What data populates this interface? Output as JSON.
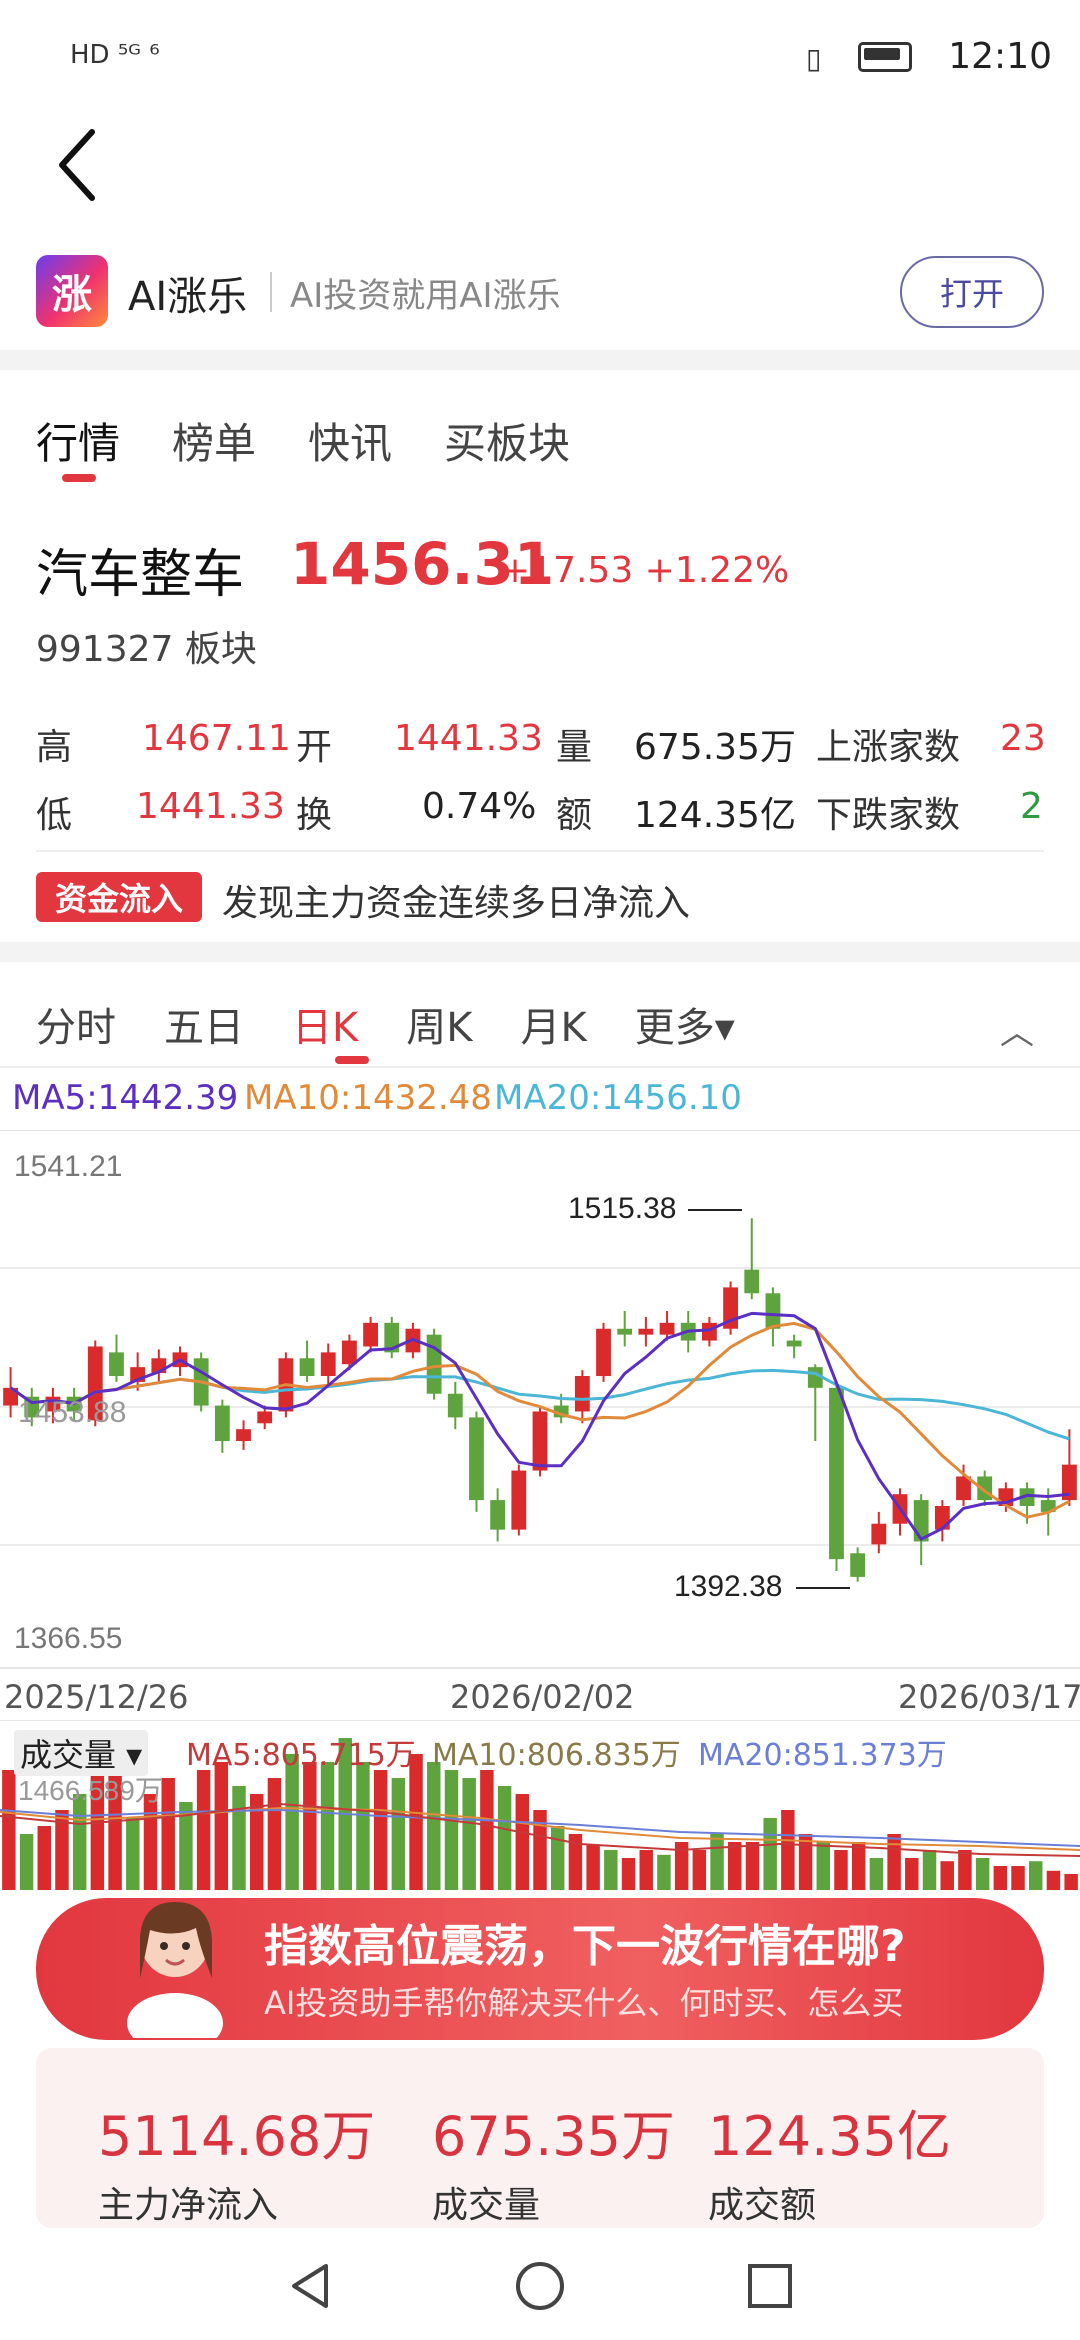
{
  "status": {
    "left_icons": "HD ⁵ᴳ ⁶",
    "time": "12:10"
  },
  "brand": {
    "logo_text": "涨",
    "name": "AI涨乐",
    "slogan": "AI投资就用AI涨乐",
    "open_label": "打开"
  },
  "tabs1": [
    "行情",
    "榜单",
    "快讯",
    "买板块"
  ],
  "security": {
    "name": "汽车整车",
    "price": "1456.31",
    "change": "+17.53 +1.22%",
    "code": "991327 板块"
  },
  "stats": {
    "high_label": "高",
    "high": "1467.11",
    "open_label": "开",
    "open": "1441.33",
    "vol_label": "量",
    "vol": "675.35万",
    "up_label": "上涨家数",
    "up": "23",
    "low_label": "低",
    "low": "1441.33",
    "turn_label": "换",
    "turn": "0.74%",
    "amt_label": "额",
    "amt": "124.35亿",
    "down_label": "下跌家数",
    "down": "2"
  },
  "fund": {
    "tag": "资金流入",
    "text": "发现主力资金连续多日净流入"
  },
  "tabs2": [
    "分时",
    "五日",
    "日K",
    "周K",
    "月K",
    "更多▾"
  ],
  "ma": {
    "ma5": "MA5:1442.39",
    "ma10": "MA10:1432.48",
    "ma20": "MA20:1456.10"
  },
  "chart_data": {
    "type": "candlestick",
    "ymax_label": "1541.21",
    "ymin_label": "1366.55",
    "mid_label": "1453.88",
    "high_label": "1515.38",
    "low_label": "1392.38",
    "ylim": [
      1366.55,
      1541.21
    ],
    "x_labels": [
      "2025/12/26",
      "2026/02/02",
      "2026/03/17"
    ],
    "candles": [
      {
        "o": 1452,
        "c": 1458,
        "h": 1465,
        "l": 1448
      },
      {
        "o": 1455,
        "c": 1448,
        "h": 1458,
        "l": 1445
      },
      {
        "o": 1450,
        "c": 1455,
        "h": 1458,
        "l": 1446
      },
      {
        "o": 1455,
        "c": 1450,
        "h": 1458,
        "l": 1447
      },
      {
        "o": 1447,
        "c": 1472,
        "h": 1474,
        "l": 1445
      },
      {
        "o": 1470,
        "c": 1462,
        "h": 1476,
        "l": 1460
      },
      {
        "o": 1460,
        "c": 1465,
        "h": 1470,
        "l": 1457
      },
      {
        "o": 1463,
        "c": 1468,
        "h": 1471,
        "l": 1460
      },
      {
        "o": 1465,
        "c": 1470,
        "h": 1472,
        "l": 1462
      },
      {
        "o": 1468,
        "c": 1452,
        "h": 1470,
        "l": 1450
      },
      {
        "o": 1452,
        "c": 1440,
        "h": 1454,
        "l": 1436
      },
      {
        "o": 1440,
        "c": 1444,
        "h": 1447,
        "l": 1437
      },
      {
        "o": 1446,
        "c": 1450,
        "h": 1452,
        "l": 1444
      },
      {
        "o": 1450,
        "c": 1468,
        "h": 1470,
        "l": 1448
      },
      {
        "o": 1468,
        "c": 1462,
        "h": 1474,
        "l": 1460
      },
      {
        "o": 1462,
        "c": 1470,
        "h": 1473,
        "l": 1459
      },
      {
        "o": 1466,
        "c": 1474,
        "h": 1476,
        "l": 1464
      },
      {
        "o": 1472,
        "c": 1480,
        "h": 1482,
        "l": 1470
      },
      {
        "o": 1480,
        "c": 1470,
        "h": 1482,
        "l": 1468
      },
      {
        "o": 1470,
        "c": 1478,
        "h": 1480,
        "l": 1468
      },
      {
        "o": 1476,
        "c": 1456,
        "h": 1478,
        "l": 1454
      },
      {
        "o": 1456,
        "c": 1448,
        "h": 1460,
        "l": 1444
      },
      {
        "o": 1448,
        "c": 1420,
        "h": 1450,
        "l": 1416
      },
      {
        "o": 1420,
        "c": 1410,
        "h": 1424,
        "l": 1406
      },
      {
        "o": 1410,
        "c": 1430,
        "h": 1432,
        "l": 1408
      },
      {
        "o": 1430,
        "c": 1450,
        "h": 1452,
        "l": 1428
      },
      {
        "o": 1452,
        "c": 1448,
        "h": 1456,
        "l": 1446
      },
      {
        "o": 1450,
        "c": 1462,
        "h": 1464,
        "l": 1446
      },
      {
        "o": 1462,
        "c": 1478,
        "h": 1480,
        "l": 1460
      },
      {
        "o": 1478,
        "c": 1476,
        "h": 1484,
        "l": 1472
      },
      {
        "o": 1476,
        "c": 1478,
        "h": 1482,
        "l": 1472
      },
      {
        "o": 1476,
        "c": 1480,
        "h": 1484,
        "l": 1474
      },
      {
        "o": 1480,
        "c": 1474,
        "h": 1484,
        "l": 1470
      },
      {
        "o": 1474,
        "c": 1480,
        "h": 1482,
        "l": 1472
      },
      {
        "o": 1478,
        "c": 1492,
        "h": 1494,
        "l": 1476
      },
      {
        "o": 1498,
        "c": 1490,
        "h": 1515.38,
        "l": 1488
      },
      {
        "o": 1490,
        "c": 1478,
        "h": 1492,
        "l": 1472
      },
      {
        "o": 1474,
        "c": 1472,
        "h": 1476,
        "l": 1468
      },
      {
        "o": 1465,
        "c": 1458,
        "h": 1466,
        "l": 1440
      },
      {
        "o": 1458,
        "c": 1400,
        "h": 1460,
        "l": 1396
      },
      {
        "o": 1402,
        "c": 1394,
        "h": 1404,
        "l": 1392.38
      },
      {
        "o": 1405,
        "c": 1412,
        "h": 1416,
        "l": 1402
      },
      {
        "o": 1412,
        "c": 1422,
        "h": 1424,
        "l": 1408
      },
      {
        "o": 1420,
        "c": 1406,
        "h": 1422,
        "l": 1398
      },
      {
        "o": 1410,
        "c": 1418,
        "h": 1420,
        "l": 1406
      },
      {
        "o": 1420,
        "c": 1428,
        "h": 1432,
        "l": 1418
      },
      {
        "o": 1428,
        "c": 1420,
        "h": 1430,
        "l": 1418
      },
      {
        "o": 1418,
        "c": 1424,
        "h": 1426,
        "l": 1416
      },
      {
        "o": 1424,
        "c": 1418,
        "h": 1426,
        "l": 1412
      },
      {
        "o": 1420,
        "c": 1416,
        "h": 1424,
        "l": 1408
      },
      {
        "o": 1420,
        "c": 1432,
        "h": 1444,
        "l": 1418
      }
    ]
  },
  "volume": {
    "label": "成交量 ▾",
    "ma5": "MA5:805.715万",
    "ma10": "MA10:806.835万",
    "ma20": "MA20:851.373万",
    "axis_label": "1466.589万",
    "bars": [
      0.75,
      0.35,
      0.4,
      0.5,
      0.6,
      0.9,
      0.8,
      0.45,
      0.6,
      0.7,
      0.55,
      0.75,
      0.8,
      0.65,
      0.6,
      0.7,
      0.85,
      0.8,
      0.8,
      0.95,
      0.8,
      0.75,
      0.7,
      0.85,
      0.8,
      0.75,
      0.7,
      0.75,
      0.65,
      0.6,
      0.5,
      0.4,
      0.35,
      0.28,
      0.25,
      0.2,
      0.25,
      0.22,
      0.3,
      0.25,
      0.35,
      0.3,
      0.3,
      0.45,
      0.5,
      0.35,
      0.3,
      0.25,
      0.3,
      0.2,
      0.35,
      0.2,
      0.25,
      0.18,
      0.25,
      0.2,
      0.15,
      0.15,
      0.18,
      0.12,
      0.1
    ]
  },
  "banner": {
    "title": "指数高位震荡，下一波行情在哪?",
    "subtitle": "AI投资助手帮你解决买什么、何时买、怎么买"
  },
  "summary": [
    {
      "value": "5114.68万",
      "label": "主力净流入"
    },
    {
      "value": "675.35万",
      "label": "成交量"
    },
    {
      "value": "124.35亿",
      "label": "成交额"
    }
  ]
}
